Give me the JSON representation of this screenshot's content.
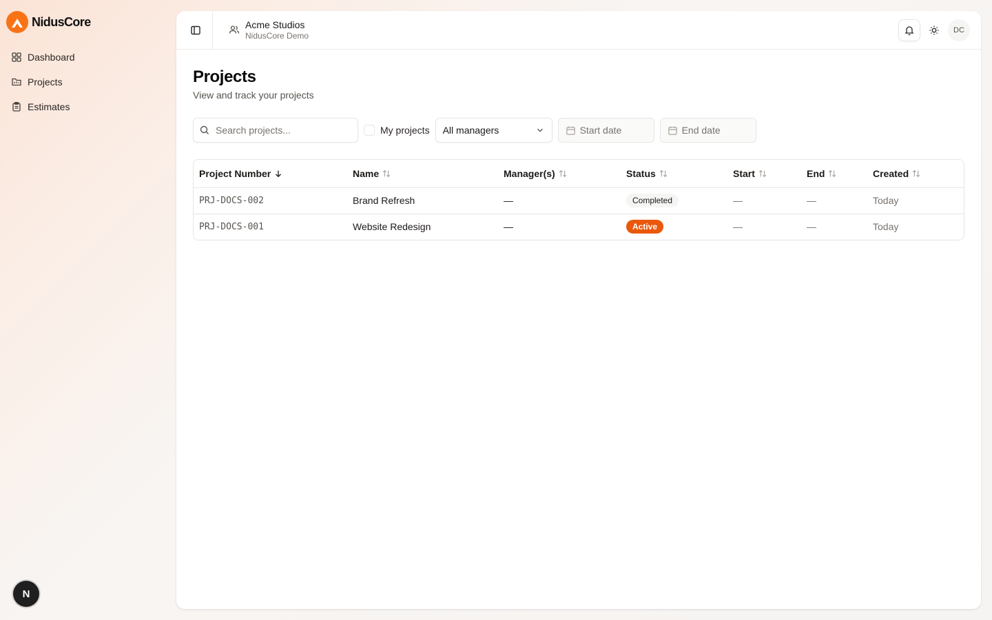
{
  "brand": {
    "name": "NidusCore",
    "accent": "#f97316"
  },
  "sidebar": {
    "items": [
      {
        "label": "Dashboard",
        "icon": "layout-grid-icon"
      },
      {
        "label": "Projects",
        "icon": "folder-icon"
      },
      {
        "label": "Estimates",
        "icon": "clipboard-icon"
      }
    ],
    "fab_label": "N"
  },
  "topbar": {
    "org_name": "Acme Studios",
    "org_sub": "NidusCore Demo",
    "avatar_initials": "DC"
  },
  "page": {
    "title": "Projects",
    "subtitle": "View and track your projects"
  },
  "filters": {
    "search_placeholder": "Search projects...",
    "my_projects_label": "My projects",
    "manager_select_value": "All managers",
    "start_date_label": "Start date",
    "end_date_label": "End date"
  },
  "table": {
    "columns": [
      "Project Number",
      "Name",
      "Manager(s)",
      "Status",
      "Start",
      "End",
      "Created"
    ],
    "rows": [
      {
        "number": "PRJ-DOCS-002",
        "name": "Brand Refresh",
        "managers": "—",
        "status": "Completed",
        "start": "—",
        "end": "—",
        "created": "Today"
      },
      {
        "number": "PRJ-DOCS-001",
        "name": "Website Redesign",
        "managers": "—",
        "status": "Active",
        "start": "—",
        "end": "—",
        "created": "Today"
      }
    ]
  },
  "colors": {
    "active_badge": "#ea580c",
    "completed_badge": "#f5f5f4"
  }
}
